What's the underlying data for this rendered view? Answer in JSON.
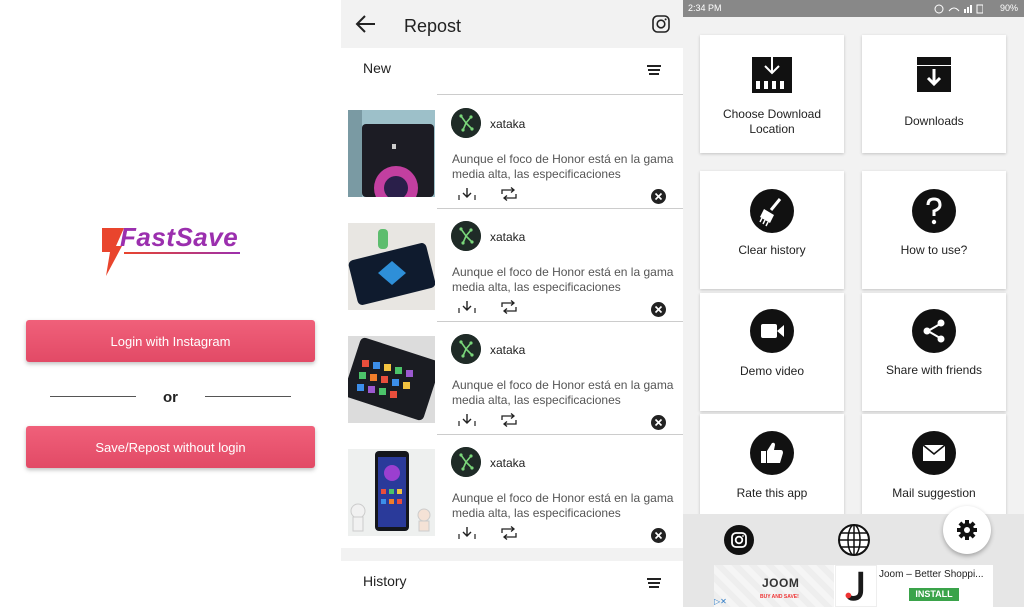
{
  "login_screen": {
    "brand": "FastSave",
    "login_button": "Login with Instagram",
    "or_text": "or",
    "no_login_button": "Save/Repost without login"
  },
  "repost_screen": {
    "title": "Repost",
    "new_section": "New",
    "history_section": "History",
    "posts": [
      {
        "user": "xataka",
        "caption": "Aunque el foco de Honor está en la gama media alta, las especificaciones"
      },
      {
        "user": "xataka",
        "caption": "Aunque el foco de Honor está en la gama media alta, las especificaciones"
      },
      {
        "user": "xataka",
        "caption": "Aunque el foco de Honor está en la gama media alta, las especificaciones"
      },
      {
        "user": "xataka",
        "caption": "Aunque el foco de Honor está en la gama media alta, las especificaciones"
      }
    ]
  },
  "menu_screen": {
    "status": {
      "time": "2:34 PM",
      "battery": "90%"
    },
    "tiles": [
      {
        "label_line1": "Choose Download",
        "label_line2": "Location",
        "icon": "download-location-icon"
      },
      {
        "label_line1": "Downloads",
        "label_line2": "",
        "icon": "downloads-box-icon"
      },
      {
        "label_line1": "Clear history",
        "label_line2": "",
        "icon": "broom-icon"
      },
      {
        "label_line1": "How to use?",
        "label_line2": "",
        "icon": "question-icon"
      },
      {
        "label_line1": "Demo video",
        "label_line2": "",
        "icon": "video-camera-icon"
      },
      {
        "label_line1": "Share with friends",
        "label_line2": "",
        "icon": "share-icon"
      },
      {
        "label_line1": "Rate this app",
        "label_line2": "",
        "icon": "thumbs-up-icon"
      },
      {
        "label_line1": "Mail suggestion",
        "label_line2": "",
        "icon": "mail-icon"
      }
    ],
    "ad": {
      "brand": "JOOM",
      "tagline": "BUY AND SAVE!",
      "title": "Joom – Better Shoppi...",
      "install": "INSTALL"
    }
  },
  "colors": {
    "accent": "#e24a66",
    "dark_icon": "#111111"
  }
}
